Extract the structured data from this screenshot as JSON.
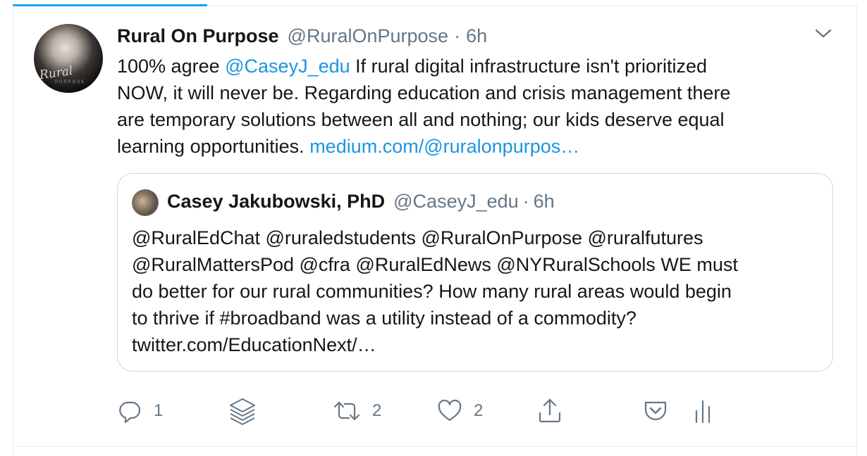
{
  "tweet": {
    "display_name": "Rural On Purpose",
    "handle": "@RuralOnPurpose",
    "separator": "·",
    "time": "6h",
    "avatar_text": "Rural",
    "avatar_subtext": "PURPOSE",
    "text_line1_pre": "100% agree ",
    "mention": "@CaseyJ_edu",
    "text_line1_post": "  If rural digital infrastructure isn't prioritized",
    "text_line2": "NOW, it will never be. Regarding education and crisis management there",
    "text_line3": "are temporary solutions between all and nothing; our kids deserve equal",
    "text_line4_pre": "learning opportunities. ",
    "link": "medium.com/@ruralonpurpos…"
  },
  "quote": {
    "display_name": "Casey Jakubowski, PhD",
    "handle": "@CaseyJ_edu",
    "separator": "·",
    "time": "6h",
    "line1": "@RuralEdChat @ruraledstudents @RuralOnPurpose @ruralfutures",
    "line2": "@RuralMattersPod @cfra @RuralEdNews @NYRuralSchools WE must",
    "line3": "do better for our rural communities? How many rural areas would begin",
    "line4": "to thrive if #broadband was a utility instead of a commodity?",
    "line5": "twitter.com/EducationNext/…"
  },
  "actions": {
    "reply_count": "1",
    "retweet_count": "2",
    "like_count": "2"
  },
  "icons": {
    "reply": "reply-icon",
    "stack": "layers-icon",
    "retweet": "retweet-icon",
    "like": "heart-icon",
    "share": "share-icon",
    "pocket": "pocket-icon",
    "analytics": "analytics-icon",
    "caret": "chevron-down-icon"
  },
  "colors": {
    "accent": "#1da1f2",
    "link": "#1b95e0",
    "text": "#14171a",
    "muted": "#657786",
    "border": "#ccd6dd"
  }
}
